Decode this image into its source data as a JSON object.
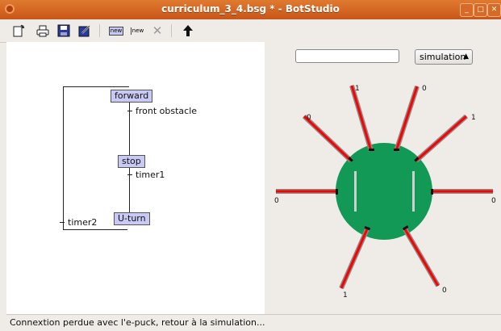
{
  "window": {
    "title": "curriculum_3_4.bsg * - BotStudio",
    "minimize_icon": "minimize-icon",
    "maximize_icon": "maximize-icon",
    "close_icon": "close-icon"
  },
  "toolbar": {
    "icons": [
      "new-document-icon",
      "print-icon",
      "save-icon",
      "edit-icon",
      "new-state-icon",
      "new-transition-icon",
      "delete-icon",
      "upload-arrow-icon"
    ],
    "new_state_label": "new",
    "new_transition_label": "new"
  },
  "graph": {
    "states": {
      "forward": "forward",
      "stop": "stop",
      "uturn": "U-turn"
    },
    "transitions": {
      "t1": "front obstacle",
      "t2": "timer1",
      "t3": "timer2"
    }
  },
  "robot": {
    "text_input_value": "",
    "mode_select": "simulation",
    "body_color": "#119955",
    "sensor_color": "#ff0000",
    "sensor_values": {
      "s_top_left": "1",
      "s_top_right": "0",
      "s_upper_left": "0",
      "s_upper_right": "1",
      "s_left": "0",
      "s_right": "0",
      "s_bottom_left": "1",
      "s_bottom_right": "0"
    }
  },
  "status_bar": {
    "message": "Connextion perdue avec l'e-puck, retour à la simulation..."
  }
}
